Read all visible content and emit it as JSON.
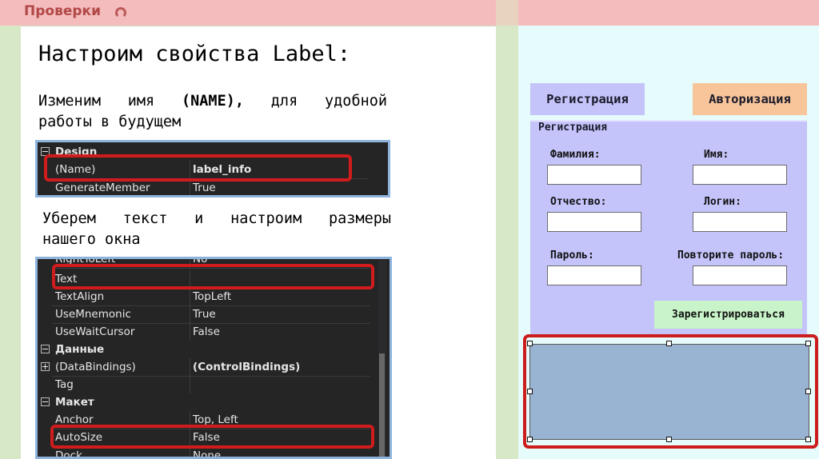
{
  "header": {
    "title": "Проверки",
    "icon": "headset-icon",
    "accent_color": "#b24848"
  },
  "slide": {
    "heading": "Настроим свойства Label:",
    "para1_line1": [
      "Изменим",
      "имя",
      "(NAME),",
      "для",
      "удобной"
    ],
    "para1_line2": "работы в будущем",
    "para2_line1": [
      "Уберем",
      "текст",
      "и",
      "настроим",
      "размеры"
    ],
    "para2_line2": "нашего окна"
  },
  "grid1": {
    "category": "Design",
    "rows": [
      {
        "name": "(Name)",
        "value": "label_info"
      },
      {
        "name": "GenerateMember",
        "value": "True"
      }
    ]
  },
  "grid2": {
    "partial_top": {
      "name": "RightToLeft",
      "value": "No"
    },
    "rows": [
      {
        "name": "Text",
        "value": ""
      },
      {
        "name": "TextAlign",
        "value": "TopLeft"
      },
      {
        "name": "UseMnemonic",
        "value": "True"
      },
      {
        "name": "UseWaitCursor",
        "value": "False"
      }
    ],
    "category_data": "Данные",
    "databindings": {
      "name": "(DataBindings)",
      "value": "(ControlBindings)"
    },
    "tag": {
      "name": "Tag",
      "value": ""
    },
    "category_layout": "Макет",
    "anchor": {
      "name": "Anchor",
      "value": "Top, Left"
    },
    "autosize": {
      "name": "AutoSize",
      "value": "False"
    },
    "partial_bottom": {
      "name": "Dock",
      "value": "None"
    }
  },
  "form": {
    "tab_register": "Регистрация",
    "tab_login": "Авторизация",
    "group_title": "Регистрация",
    "fields": {
      "surname": "Фамилия:",
      "name": "Имя:",
      "patronymic": "Отчество:",
      "login": "Логин:",
      "password": "Пароль:",
      "repeat_password": "Повторите пароль:"
    },
    "submit": "Зарегистрироваться"
  },
  "colors": {
    "highlight_red": "#d01c1c",
    "tab_register_bg": "#c4c4fb",
    "tab_login_bg": "#f8c59b",
    "submit_bg": "#c9f4c9",
    "label_bg": "#98b4d2"
  }
}
